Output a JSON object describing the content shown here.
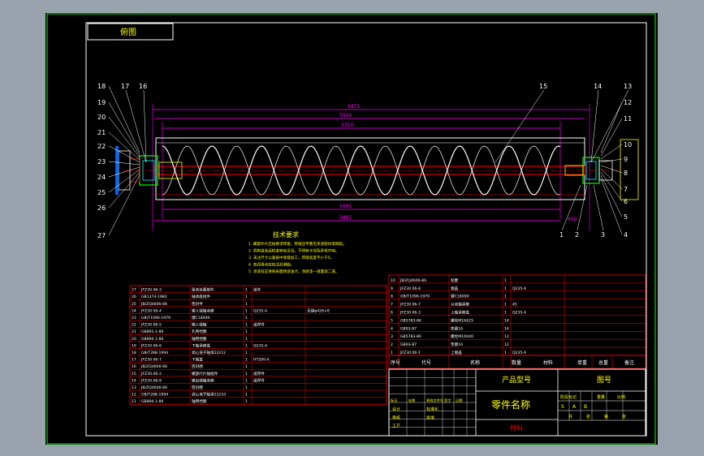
{
  "title_box": "俯图",
  "colors": {
    "frame_bg": "#9aa3ad",
    "paper": "#000000",
    "border_green": "#00ff00",
    "white": "#ffffff",
    "magenta": "#ff00ff",
    "red": "#ff0000",
    "yellow": "#ffff00",
    "cyan": "#00ffff",
    "blue": "#0066ff"
  },
  "balloons_left": [
    "18",
    "19",
    "20",
    "21",
    "22",
    "23",
    "24",
    "25",
    "26",
    "27"
  ],
  "balloons_top": [
    "17",
    "16",
    "15",
    "14",
    "13"
  ],
  "balloons_right": [
    "12",
    "11",
    "10",
    "9",
    "8",
    "7",
    "6",
    "5",
    "4"
  ],
  "balloons_bottom": [
    "1",
    "2",
    "3"
  ],
  "dimensions": {
    "top1": "6871",
    "top2": "5940",
    "top3": "5350",
    "bottom1": "5695",
    "bottom2": "5885",
    "side": "450"
  },
  "tech_requirements": {
    "title": "技术要求",
    "lines": [
      "1. 螺旋叶片应按要求焊接，焊缝应平整无夹渣裂纹等缺陷。",
      "2. 机构组装后检查转动灵活，不得有卡滞及异常声响。",
      "3. 未注尺寸公差按中等级加工，焊缝高度不小于5。",
      "4. 各润滑点应加注润滑脂。",
      "5. 涂漆前应清除表面锈迹油污，涂底漆一道面漆二道。"
    ]
  },
  "bom_left": [
    {
      "no": "27",
      "code": "JFZ30.06-3",
      "name": "驱动装置部件",
      "qty": "1",
      "material": "组件",
      "note": ""
    },
    {
      "no": "26",
      "code": "GB1374-1982",
      "name": "轴承座组件",
      "qty": "1",
      "material": "",
      "note": ""
    },
    {
      "no": "25",
      "code": "JB/ZQ4606-86",
      "name": "密封件",
      "qty": "1",
      "material": "",
      "note": ""
    },
    {
      "no": "24",
      "code": "JFZ30.06-4",
      "name": "输入端轴承座",
      "qty": "1",
      "material": "Q235-A",
      "note": "无缝φ426×8"
    },
    {
      "no": "23",
      "code": "GB/T1096-1979",
      "name": "键C18X90",
      "qty": "1",
      "material": "",
      "note": ""
    },
    {
      "no": "22",
      "code": "JFZ30.06-5",
      "name": "输入端轴",
      "qty": "1",
      "material": "组焊件",
      "note": ""
    },
    {
      "no": "21",
      "code": "GB893.1-86",
      "name": "孔用挡圈",
      "qty": "1",
      "material": "",
      "note": ""
    },
    {
      "no": "20",
      "code": "GB894.1-86",
      "name": "轴用挡圈",
      "qty": "1",
      "material": "",
      "note": ""
    },
    {
      "no": "19",
      "code": "JFZ30.06-6",
      "name": "下轴承座盖",
      "qty": "1",
      "material": "Q235-A",
      "note": ""
    },
    {
      "no": "18",
      "code": "GB/T288-1994",
      "name": "调心滚子轴承22212",
      "qty": "1",
      "material": "",
      "note": ""
    },
    {
      "no": "17",
      "code": "JFZ30.06-7",
      "name": "下端盖",
      "qty": "1",
      "material": "HT200-A",
      "note": ""
    },
    {
      "no": "16",
      "code": "JB/ZQ4606-86",
      "name": "密封圈",
      "qty": "1",
      "material": "",
      "note": ""
    },
    {
      "no": "15",
      "code": "JFZ30.06-2",
      "name": "螺旋叶片轴组件",
      "qty": "1",
      "material": "组焊件",
      "note": ""
    },
    {
      "no": "14",
      "code": "JFZ30.06-8",
      "name": "输出端轴承座",
      "qty": "1",
      "material": "组焊件",
      "note": ""
    },
    {
      "no": "13",
      "code": "JB/ZQ4606-86",
      "name": "密封圈",
      "qty": "1",
      "material": "",
      "note": ""
    },
    {
      "no": "12",
      "code": "GB/T288-1994",
      "name": "调心滚子轴承22210",
      "qty": "1",
      "material": "",
      "note": ""
    },
    {
      "no": "11",
      "code": "GB894.1-86",
      "name": "轴用挡圈",
      "qty": "1",
      "material": "",
      "note": ""
    }
  ],
  "bom_right": [
    {
      "no": "10",
      "code": "JB/ZQ4606-86",
      "name": "毡圈",
      "qty": "1",
      "material": "",
      "note": ""
    },
    {
      "no": "9",
      "code": "JFZ30.06-8",
      "name": "端盖",
      "qty": "1",
      "material": "Q235-A",
      "note": ""
    },
    {
      "no": "8",
      "code": "GB/T1096-1979",
      "name": "键C18X90",
      "qty": "1",
      "material": "",
      "note": ""
    },
    {
      "no": "7",
      "code": "JFZ30.06-7",
      "name": "从动轴承座",
      "qty": "1",
      "material": "45",
      "note": ""
    },
    {
      "no": "6",
      "code": "JFZ30.06-3",
      "name": "上轴承座盖",
      "qty": "1",
      "material": "Q235-A",
      "note": ""
    },
    {
      "no": "5",
      "code": "GB5783-86",
      "name": "螺栓M16X25",
      "qty": "14",
      "material": "",
      "note": ""
    },
    {
      "no": "4",
      "code": "GB93-87",
      "name": "垫圈16",
      "qty": "14",
      "material": "",
      "note": ""
    },
    {
      "no": "3",
      "code": "GB5783-86",
      "name": "螺栓M16X40",
      "qty": "12",
      "material": "",
      "note": ""
    },
    {
      "no": "2",
      "code": "GB93-87",
      "name": "垫圈16",
      "qty": "12",
      "material": "",
      "note": ""
    },
    {
      "no": "1",
      "code": "JFZ30.06-1",
      "name": "上端盖",
      "qty": "1",
      "material": "Q235-A",
      "note": ""
    }
  ],
  "bom_header": {
    "no": "序号",
    "code": "代号",
    "name": "名称",
    "qty": "数量",
    "material": "材料",
    "unit_wt": "单重",
    "total_wt": "总重",
    "note": "备注"
  },
  "title_block": {
    "product_model": "产品型号",
    "drawing_no": "图号",
    "part_name": "零件名称",
    "material": "材料",
    "marks": [
      "标记",
      "处数",
      "更改文件号",
      "签字",
      "日期"
    ],
    "sign_rows": [
      "设计",
      "审核",
      "工艺"
    ],
    "sign_cols": [
      "标准化",
      "批准"
    ],
    "stage_labels": [
      "阶段标记",
      "重量",
      "比例"
    ],
    "stage_cells": [
      "S",
      "A",
      "B"
    ],
    "sheet_labels": [
      "共",
      "张",
      "第",
      "张"
    ]
  }
}
